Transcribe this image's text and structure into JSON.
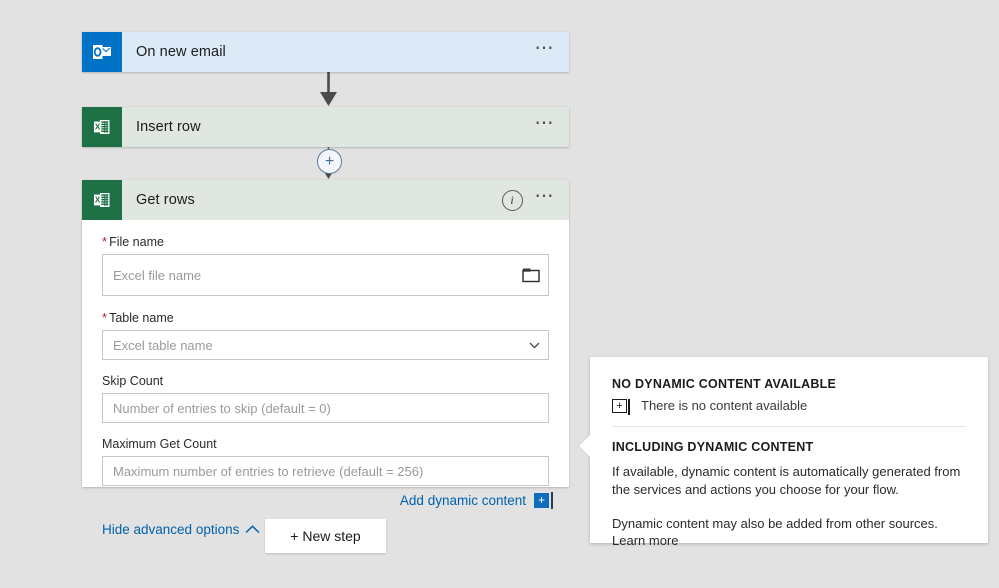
{
  "canvas": {
    "background_color": "#e2e2e2"
  },
  "flow": {
    "steps": [
      {
        "id": "on-new-email",
        "title": "On new email",
        "connector": "outlook",
        "header_color": "#dceaf7",
        "icon_color": "#0072c6",
        "icon_name": "outlook-icon",
        "menu_label": "⋯"
      },
      {
        "id": "insert-row",
        "title": "Insert row",
        "connector": "excel",
        "header_color": "#dfe7e0",
        "icon_color": "#1e7145",
        "icon_name": "excel-icon",
        "menu_label": "⋯"
      },
      {
        "id": "get-rows",
        "title": "Get rows",
        "connector": "excel",
        "header_color": "#dfe7e0",
        "icon_color": "#1e7145",
        "icon_name": "excel-icon",
        "info_label": "i",
        "menu_label": "⋯"
      }
    ],
    "add_step_button_label": "+"
  },
  "get_rows_form": {
    "fields": [
      {
        "label": "File name",
        "required": true,
        "required_marker": "*",
        "placeholder": "Excel file name",
        "value": "",
        "trailing_icon": "folder-icon"
      },
      {
        "label": "Table name",
        "required": true,
        "required_marker": "*",
        "placeholder": "Excel table name",
        "value": "",
        "trailing_icon": "chevron-down-icon"
      },
      {
        "label": "Skip Count",
        "required": false,
        "required_marker": "",
        "placeholder": "Number of entries to skip (default = 0)",
        "value": "",
        "trailing_icon": ""
      },
      {
        "label": "Maximum Get Count",
        "required": false,
        "required_marker": "",
        "placeholder": "Maximum number of entries to retrieve (default = 256)",
        "value": "",
        "trailing_icon": ""
      }
    ],
    "add_dynamic_content_label": "Add dynamic content",
    "add_dynamic_content_badge": "+",
    "hide_advanced_options_label": "Hide advanced options",
    "hide_advanced_options_chevron": "chevron-up-icon"
  },
  "new_step": {
    "label": "+ New step"
  },
  "dynamic_content_panel": {
    "no_content_heading": "NO DYNAMIC CONTENT AVAILABLE",
    "no_content_badge": "+",
    "no_content_text": "There is no content available",
    "including_heading": "INCLUDING DYNAMIC CONTENT",
    "paragraph_1": "If available, dynamic content is automatically generated from the services and actions you choose for your flow.",
    "paragraph_2": "Dynamic content may also be added from other sources.",
    "learn_more_label": "Learn more"
  },
  "colors": {
    "accent_link": "#0062ad",
    "badge_blue": "#0f6cbd",
    "required_red": "#a4262c",
    "outlook_blue": "#0072c6",
    "excel_green": "#1e7145"
  }
}
